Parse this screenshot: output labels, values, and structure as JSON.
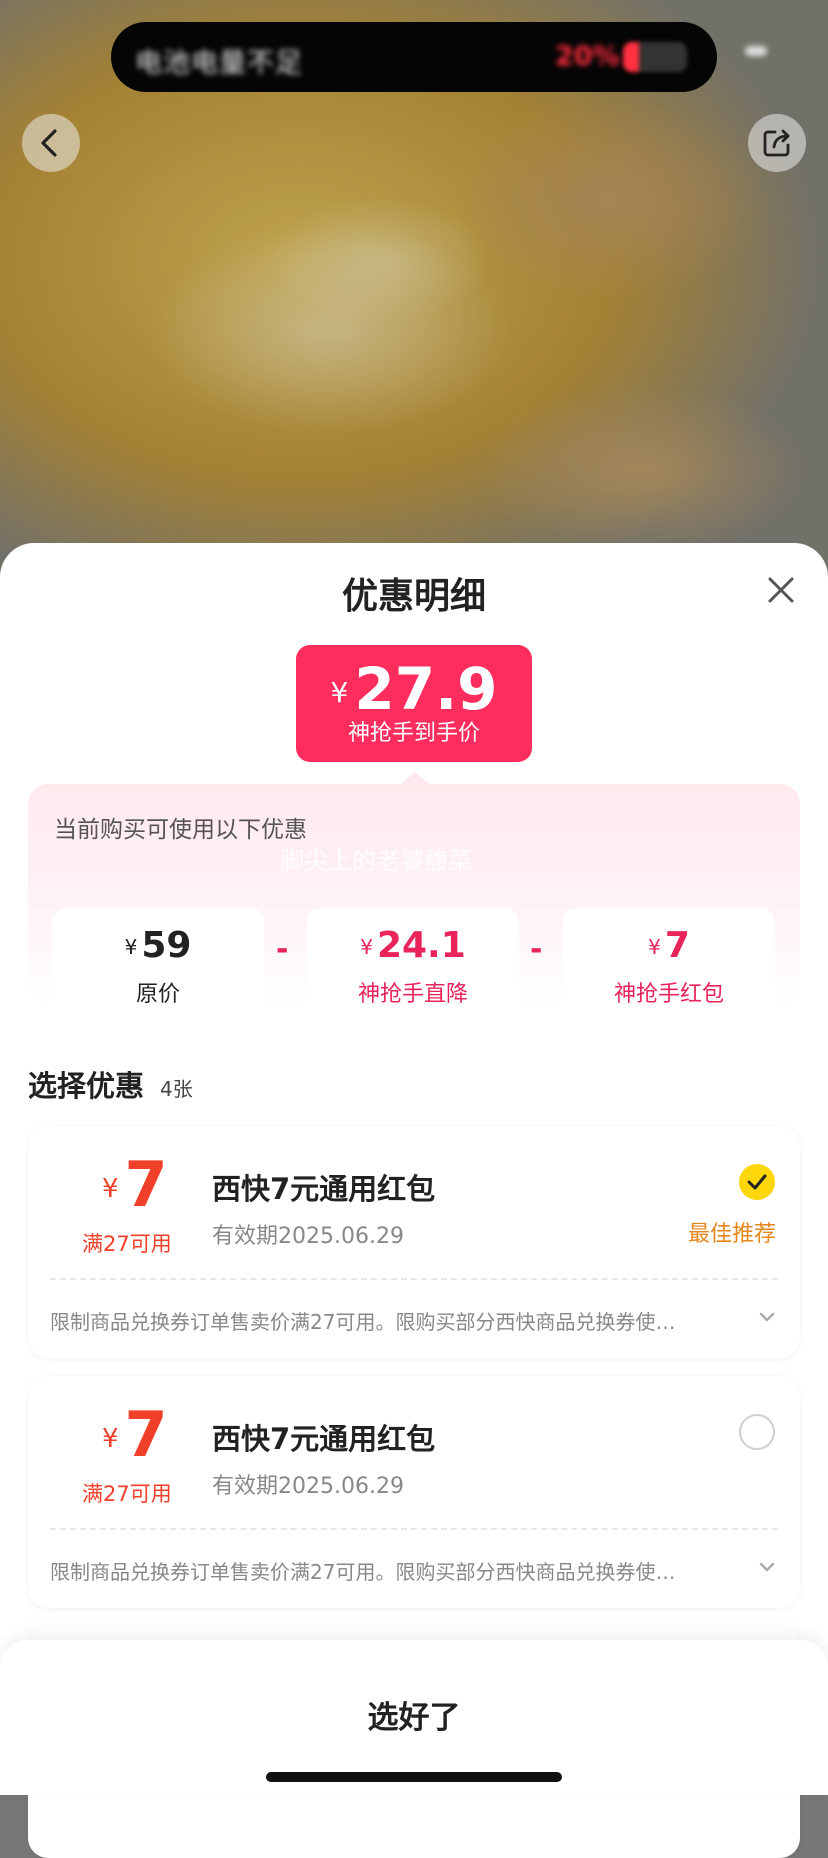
{
  "status_pill": {
    "message": "电池电量不足",
    "battery_percent": "20%"
  },
  "header": {
    "back_icon": "chevron-left-icon",
    "share_icon": "share-icon"
  },
  "sheet": {
    "title": "优惠明细",
    "close_icon": "close-icon",
    "final_price": {
      "currency": "¥",
      "value": "27.9",
      "label": "神抢手到手价"
    },
    "panel": {
      "intro": "当前购买可使用以下优惠",
      "watermark": "脚尖上的老饕馥菜",
      "items": [
        {
          "currency": "¥",
          "value": "59",
          "label": "原价"
        },
        {
          "currency": "¥",
          "value": "24.1",
          "label": "神抢手直降"
        },
        {
          "currency": "¥",
          "value": "7",
          "label": "神抢手红包"
        }
      ],
      "operator": "-"
    },
    "section": {
      "title": "选择优惠",
      "count": "4张"
    },
    "coupons": [
      {
        "currency": "¥",
        "amount": "7",
        "condition": "满27可用",
        "title": "西快7元通用红包",
        "validity": "有效期2025.06.29",
        "selected": true,
        "tag": "最佳推荐",
        "description": "限制商品兑换券订单售卖价满27可用。限购买部分西快商品兑换券使…"
      },
      {
        "currency": "¥",
        "amount": "7",
        "condition": "满27可用",
        "title": "西快7元通用红包",
        "validity": "有效期2025.06.29",
        "selected": false,
        "tag": "",
        "description": "限制商品兑换券订单售卖价满27可用。限购买部分西快商品兑换券使…"
      }
    ],
    "done_button": "选好了"
  },
  "colors": {
    "accent": "#ff2c5e",
    "coupon_red": "#f0402a",
    "best_tag": "#e6861b",
    "check_yellow": "#ffd60a"
  }
}
